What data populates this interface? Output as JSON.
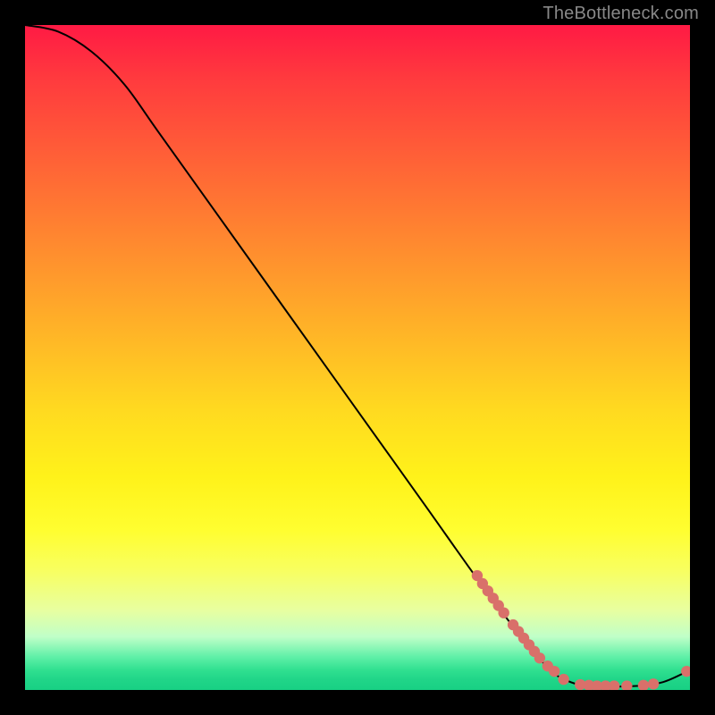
{
  "attribution": "TheBottleneck.com",
  "chart_data": {
    "type": "line",
    "title": "",
    "xlabel": "",
    "ylabel": "",
    "xlim": [
      0,
      100
    ],
    "ylim": [
      0,
      100
    ],
    "curve": [
      {
        "x": 0,
        "y": 100
      },
      {
        "x": 5,
        "y": 99
      },
      {
        "x": 10,
        "y": 96
      },
      {
        "x": 15,
        "y": 91
      },
      {
        "x": 20,
        "y": 84
      },
      {
        "x": 30,
        "y": 70
      },
      {
        "x": 40,
        "y": 56
      },
      {
        "x": 50,
        "y": 42
      },
      {
        "x": 60,
        "y": 28
      },
      {
        "x": 70,
        "y": 14
      },
      {
        "x": 78,
        "y": 4
      },
      {
        "x": 82,
        "y": 1.2
      },
      {
        "x": 86,
        "y": 0.6
      },
      {
        "x": 92,
        "y": 0.6
      },
      {
        "x": 96,
        "y": 1.2
      },
      {
        "x": 100,
        "y": 3
      }
    ],
    "markers": [
      {
        "x": 68.0,
        "y": 17.2
      },
      {
        "x": 68.8,
        "y": 16.0
      },
      {
        "x": 69.6,
        "y": 14.9
      },
      {
        "x": 70.4,
        "y": 13.8
      },
      {
        "x": 71.2,
        "y": 12.7
      },
      {
        "x": 72.0,
        "y": 11.6
      },
      {
        "x": 73.4,
        "y": 9.8
      },
      {
        "x": 74.2,
        "y": 8.8
      },
      {
        "x": 75.0,
        "y": 7.8
      },
      {
        "x": 75.8,
        "y": 6.8
      },
      {
        "x": 76.6,
        "y": 5.8
      },
      {
        "x": 77.4,
        "y": 4.8
      },
      {
        "x": 78.6,
        "y": 3.6
      },
      {
        "x": 79.6,
        "y": 2.8
      },
      {
        "x": 81.0,
        "y": 1.6
      },
      {
        "x": 83.5,
        "y": 0.8
      },
      {
        "x": 84.8,
        "y": 0.7
      },
      {
        "x": 86.0,
        "y": 0.6
      },
      {
        "x": 87.3,
        "y": 0.6
      },
      {
        "x": 88.6,
        "y": 0.6
      },
      {
        "x": 90.5,
        "y": 0.6
      },
      {
        "x": 93.0,
        "y": 0.7
      },
      {
        "x": 94.5,
        "y": 0.9
      },
      {
        "x": 99.5,
        "y": 2.8
      }
    ],
    "gradient_stops": [
      {
        "pct": 0,
        "color": "#ff1a44"
      },
      {
        "pct": 50,
        "color": "#ffd020"
      },
      {
        "pct": 80,
        "color": "#ffff40"
      },
      {
        "pct": 100,
        "color": "#18d084"
      }
    ]
  }
}
